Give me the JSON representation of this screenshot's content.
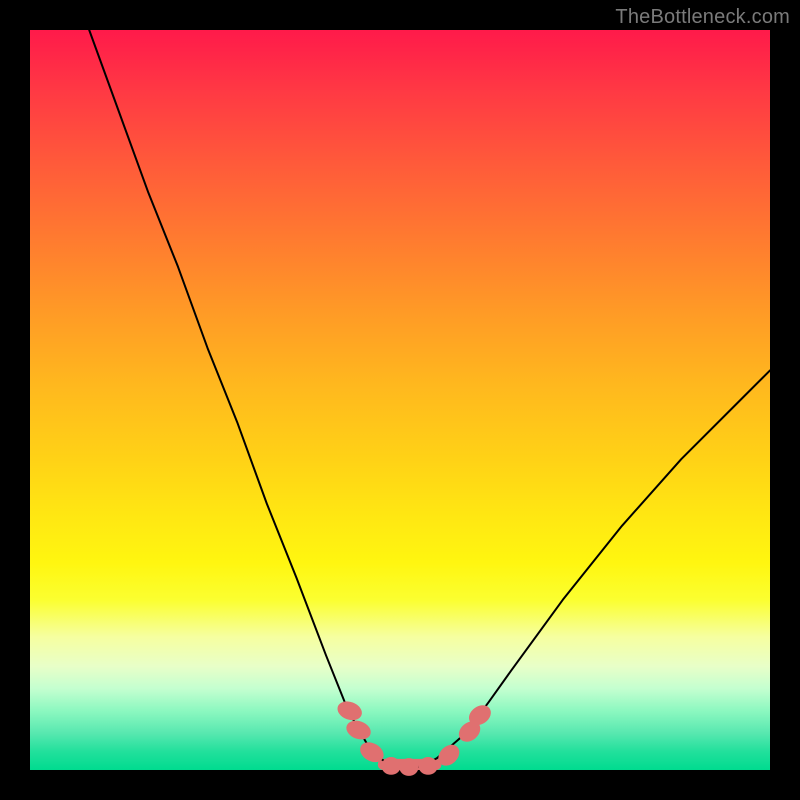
{
  "watermark": "TheBottleneck.com",
  "chart_data": {
    "type": "line",
    "title": "",
    "xlabel": "",
    "ylabel": "",
    "xlim": [
      0,
      100
    ],
    "ylim": [
      0,
      100
    ],
    "grid": false,
    "series": [
      {
        "name": "curve",
        "stroke": "#000000",
        "stroke_width": 2,
        "x": [
          8,
          12,
          16,
          20,
          24,
          28,
          32,
          36,
          40,
          43,
          45.5,
          47,
          49,
          50,
          51,
          53,
          55,
          58,
          60,
          62,
          65,
          72,
          80,
          88,
          96,
          100
        ],
        "y": [
          100,
          89,
          78,
          68,
          57,
          47,
          36,
          26,
          15.5,
          8,
          3.6,
          1.8,
          0.5,
          0.2,
          0.2,
          0.5,
          1.6,
          4.2,
          6.5,
          9.2,
          13.4,
          23,
          33,
          42,
          50,
          54
        ]
      }
    ],
    "markers": [
      {
        "shape": "ellipse",
        "cx": 43.2,
        "cy": 8.0,
        "rx": 1.2,
        "ry": 1.7,
        "rot": -70,
        "fill": "#e07070"
      },
      {
        "shape": "ellipse",
        "cx": 44.4,
        "cy": 5.4,
        "rx": 1.2,
        "ry": 1.7,
        "rot": -70,
        "fill": "#e07070"
      },
      {
        "shape": "ellipse",
        "cx": 46.2,
        "cy": 2.4,
        "rx": 1.2,
        "ry": 1.7,
        "rot": -60,
        "fill": "#e07070"
      },
      {
        "shape": "ellipse",
        "cx": 48.8,
        "cy": 0.55,
        "rx": 1.3,
        "ry": 1.2,
        "rot": 0,
        "fill": "#e07070"
      },
      {
        "shape": "ellipse",
        "cx": 51.2,
        "cy": 0.4,
        "rx": 1.3,
        "ry": 1.2,
        "rot": 0,
        "fill": "#e07070"
      },
      {
        "shape": "ellipse",
        "cx": 53.8,
        "cy": 0.55,
        "rx": 1.3,
        "ry": 1.2,
        "rot": 0,
        "fill": "#e07070"
      },
      {
        "shape": "ellipse",
        "cx": 56.6,
        "cy": 2.0,
        "rx": 1.2,
        "ry": 1.6,
        "rot": 45,
        "fill": "#e07070"
      },
      {
        "shape": "ellipse",
        "cx": 59.4,
        "cy": 5.2,
        "rx": 1.2,
        "ry": 1.6,
        "rot": 50,
        "fill": "#e07070"
      },
      {
        "shape": "ellipse",
        "cx": 60.8,
        "cy": 7.4,
        "rx": 1.2,
        "ry": 1.6,
        "rot": 55,
        "fill": "#e07070"
      }
    ],
    "band": {
      "y0": 0,
      "y1": 1.5,
      "x0": 47.0,
      "x1": 55.6,
      "fill": "#e07070"
    },
    "background_gradient": {
      "top": "#ff1a4a",
      "mid": "#ffe812",
      "bottom": "#00db8f"
    }
  }
}
